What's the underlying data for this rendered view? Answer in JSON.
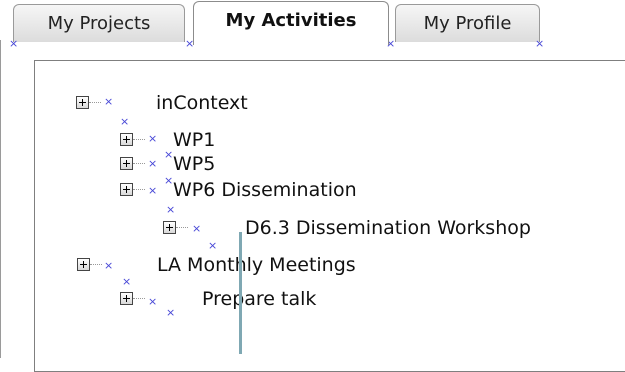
{
  "tabs": {
    "projects": "My Projects",
    "activities": "My Activities",
    "profile": "My Profile"
  },
  "tree": {
    "incontext": "inContext",
    "wp1": "WP1",
    "wp5": "WP5",
    "wp6": "WP6 Dissemination",
    "d63": "D6.3 Dissemination Workshop",
    "la": "LA Monthly Meetings",
    "talk": "Prepare talk"
  },
  "icons": {
    "expander": "plus-box-icon",
    "marker": "broken-image-x-icon"
  },
  "colors": {
    "marker": "#4646d6",
    "caret": "#7fa8b3",
    "tab_border": "#9a9a9a"
  }
}
